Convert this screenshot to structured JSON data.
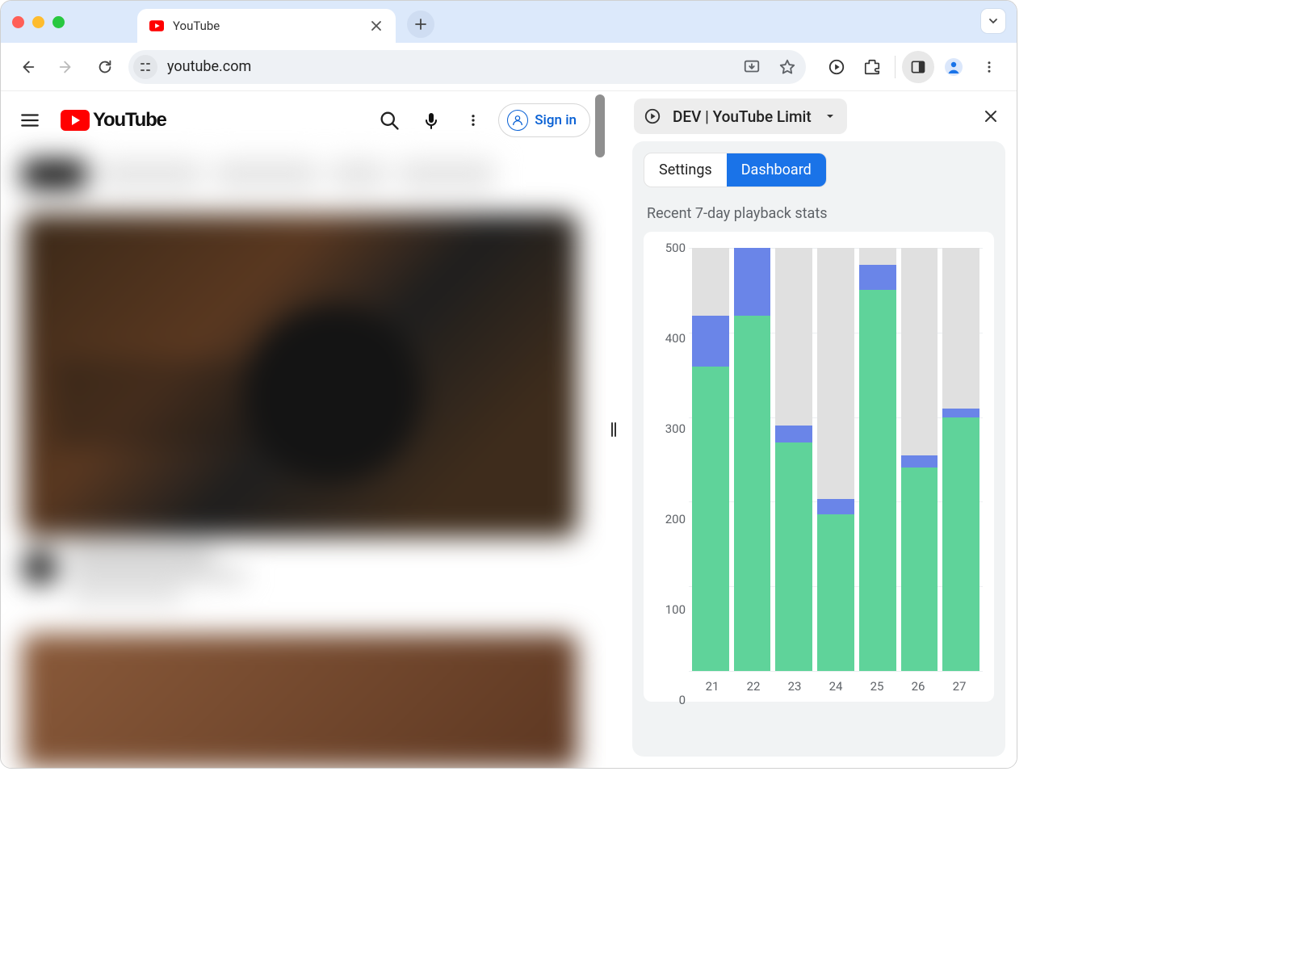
{
  "browser": {
    "tab_title": "YouTube",
    "url": "youtube.com"
  },
  "youtube": {
    "brand": "YouTube",
    "sign_in": "Sign in"
  },
  "devtools": {
    "extension_name": "DEV | YouTube Limit",
    "tabs": {
      "settings": "Settings",
      "dashboard": "Dashboard"
    },
    "stats_title": "Recent 7-day playback stats"
  },
  "chart_data": {
    "type": "bar",
    "categories": [
      "21",
      "22",
      "23",
      "24",
      "25",
      "26",
      "27"
    ],
    "series": [
      {
        "name": "green",
        "values": [
          360,
          420,
          270,
          185,
          450,
          240,
          300
        ]
      },
      {
        "name": "blue",
        "values": [
          60,
          80,
          20,
          18,
          30,
          15,
          10
        ]
      }
    ],
    "ylim": [
      0,
      500
    ],
    "yticks": [
      0,
      100,
      200,
      300,
      400,
      500
    ],
    "xlabel": "",
    "ylabel": "",
    "title": ""
  }
}
